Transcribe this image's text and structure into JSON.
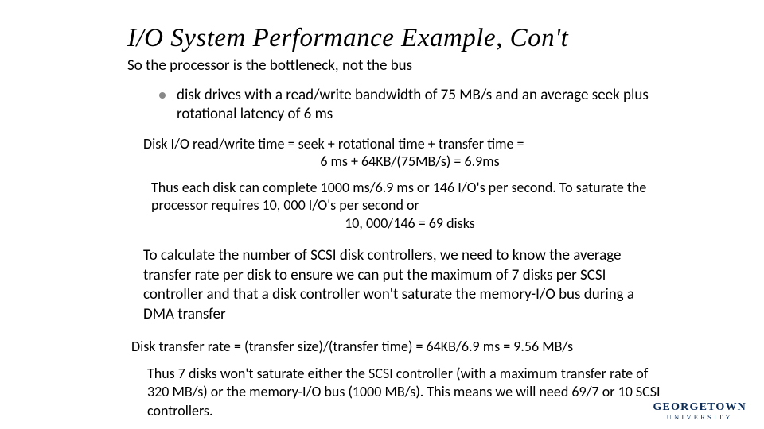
{
  "title": "I/O System Performance Example, Con't",
  "subtitle": "So the processor is the bottleneck, not the bus",
  "bullet": "disk drives with a read/write bandwidth of 75 MB/s and an average seek plus rotational latency of 6 ms",
  "calc1_line1": "Disk I/O read/write time = seek + rotational time + transfer time =",
  "calc1_line2": "6 ms + 64KB/(75MB/s) = 6.9ms",
  "calc2_line1": "Thus each disk can complete 1000 ms/6.9 ms or 146 I/O's per second.  To saturate the processor requires 10, 000 I/O's per second or",
  "calc2_line2": "10, 000/146 = 69 disks",
  "para": "To calculate the number of SCSI disk controllers, we need to know the average transfer rate per disk to ensure we can put the maximum of 7 disks per SCSI controller and that a disk controller won't saturate the memory-I/O bus during a DMA transfer",
  "calc3": "Disk transfer rate = (transfer size)/(transfer time) = 64KB/6.9 ms = 9.56 MB/s",
  "calc4": "Thus 7 disks won't saturate either the SCSI controller (with a maximum transfer rate of 320 MB/s) or the memory-I/O bus (1000 MB/s).  This means we will need 69/7 or 10 SCSI controllers.",
  "logo_main": "GEORGETOWN",
  "logo_sub": "UNIVERSITY"
}
